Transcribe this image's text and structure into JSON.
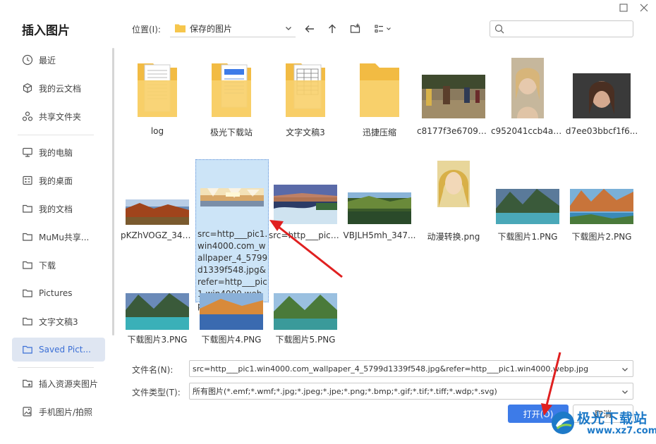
{
  "dialog": {
    "title": "插入图片"
  },
  "sidebar": {
    "items": [
      {
        "label": "最近",
        "icon": "clock-icon"
      },
      {
        "label": "我的云文档",
        "icon": "cloud-cube-icon"
      },
      {
        "label": "共享文件夹",
        "icon": "share-icon"
      },
      {
        "label": "我的电脑",
        "icon": "monitor-icon"
      },
      {
        "label": "我的桌面",
        "icon": "desktop-icon"
      },
      {
        "label": "我的文档",
        "icon": "folder-outline-icon"
      },
      {
        "label": "MuMu共享...",
        "icon": "folder-outline-icon"
      },
      {
        "label": "下载",
        "icon": "folder-outline-icon"
      },
      {
        "label": "Pictures",
        "icon": "folder-outline-icon"
      },
      {
        "label": "文字文稿3",
        "icon": "folder-outline-icon"
      },
      {
        "label": "Saved Pict...",
        "icon": "folder-outline-icon",
        "active": true
      },
      {
        "label": "插入资源夹图片",
        "icon": "star-folder-icon"
      },
      {
        "label": "手机图片/拍照",
        "icon": "phone-image-icon"
      }
    ]
  },
  "toolbar": {
    "location_label": "位置(I):",
    "location_value": "保存的图片",
    "search_placeholder": ""
  },
  "files": [
    {
      "name": "log",
      "kind": "folder-doc"
    },
    {
      "name": "极光下载站",
      "kind": "folder-doc2"
    },
    {
      "name": "文字文稿3",
      "kind": "folder-doc3"
    },
    {
      "name": "迅捷压缩",
      "kind": "folder"
    },
    {
      "name": "c8177f3e6709c...",
      "kind": "photo"
    },
    {
      "name": "c952041ccb4a5...",
      "kind": "photo"
    },
    {
      "name": "d7ee03bbcf1f6...",
      "kind": "photo"
    },
    {
      "name": "pKZhVOGZ_347...",
      "kind": "photo"
    },
    {
      "name": "src=http___pic1.win4000.com_wallpaper_4_5799d1339f548.jpg&refer=http___pic1.win4000.webp.jpg",
      "kind": "photo",
      "selected": true
    },
    {
      "name": "src=http___pic1....",
      "kind": "photo"
    },
    {
      "name": "VBJLH5mh_347...",
      "kind": "photo"
    },
    {
      "name": "动漫转换.png",
      "kind": "photo"
    },
    {
      "name": "下载图片1.PNG",
      "kind": "photo"
    },
    {
      "name": "下载图片2.PNG",
      "kind": "photo"
    },
    {
      "name": "下载图片3.PNG",
      "kind": "photo"
    },
    {
      "name": "下载图片4.PNG",
      "kind": "photo"
    },
    {
      "name": "下载图片5.PNG",
      "kind": "photo"
    }
  ],
  "bottom": {
    "filename_label": "文件名(N):",
    "filename_value": "src=http___pic1.win4000.com_wallpaper_4_5799d1339f548.jpg&refer=http___pic1.win4000.webp.jpg",
    "filetype_label": "文件类型(T):",
    "filetype_value": "所有图片(*.emf;*.wmf;*.jpg;*.jpeg;*.jpe;*.png;*.bmp;*.gif;*.tif;*.tiff;*.wdp;*.svg)",
    "open_label": "打开(O)",
    "cancel_label": "取消"
  },
  "watermark": {
    "line1": "极光下载站",
    "line2": "www.xz7.com"
  },
  "colors": {
    "accent": "#3d7be8",
    "selection": "#cce4f7",
    "annotation_arrow": "#e02020"
  }
}
